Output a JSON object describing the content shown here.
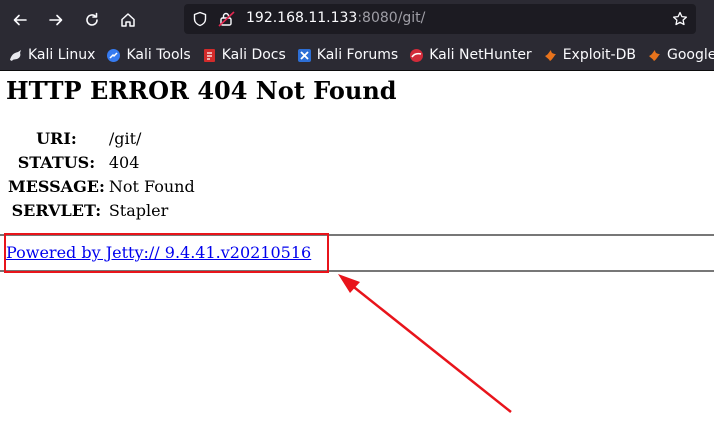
{
  "browser": {
    "url_host": "192.168.11.133",
    "url_rest": ":8080/git/",
    "bookmarks": [
      {
        "label": "Kali Linux",
        "icon": "kali-dragon-icon"
      },
      {
        "label": "Kali Tools",
        "icon": "kali-tools-icon"
      },
      {
        "label": "Kali Docs",
        "icon": "kali-docs-icon"
      },
      {
        "label": "Kali Forums",
        "icon": "kali-forums-icon"
      },
      {
        "label": "Kali NetHunter",
        "icon": "kali-nethunter-icon"
      },
      {
        "label": "Exploit-DB",
        "icon": "exploit-db-icon"
      },
      {
        "label": "Google Hacking DB",
        "icon": "google-hacking-db-icon"
      }
    ]
  },
  "page": {
    "heading": "HTTP ERROR 404 Not Found",
    "rows": [
      {
        "key": "URI:",
        "value": "/git/"
      },
      {
        "key": "STATUS:",
        "value": "404"
      },
      {
        "key": "MESSAGE:",
        "value": "Not Found"
      },
      {
        "key": "SERVLET:",
        "value": "Stapler"
      }
    ],
    "powered_by": "Powered by Jetty:// 9.4.41.v20210516"
  },
  "colors": {
    "chrome": "#2b2a33",
    "urlbar": "#1c1b22",
    "annotation": "#e8141b",
    "link": "#0000ee"
  }
}
